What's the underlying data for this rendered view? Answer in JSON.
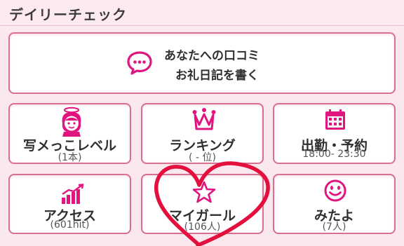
{
  "header": {
    "title": "デイリーチェック"
  },
  "colors": {
    "accent": "#e0157f",
    "border": "#d86f8e",
    "heart": "#e30f3c"
  },
  "review_card": {
    "icon": "speech-bubble-icon",
    "line1": "あなたへの口コミ",
    "line2": "お礼日記を書く"
  },
  "tiles": [
    {
      "icon": "angel-girl-icon",
      "label": "写メっこレベル",
      "sub": "(1本)"
    },
    {
      "icon": "crown-icon",
      "label": "ランキング",
      "sub": "( - 位)"
    },
    {
      "icon": "calendar-icon",
      "label": "出勤・予約",
      "sub": "18:00- 23:30"
    },
    {
      "icon": "bar-chart-icon",
      "label": "アクセス",
      "sub": "(601hit)"
    },
    {
      "icon": "star-icon",
      "label": "マイガール",
      "sub": "(106人)"
    },
    {
      "icon": "smiley-icon",
      "label": "みたよ",
      "sub": "(7人)"
    }
  ]
}
